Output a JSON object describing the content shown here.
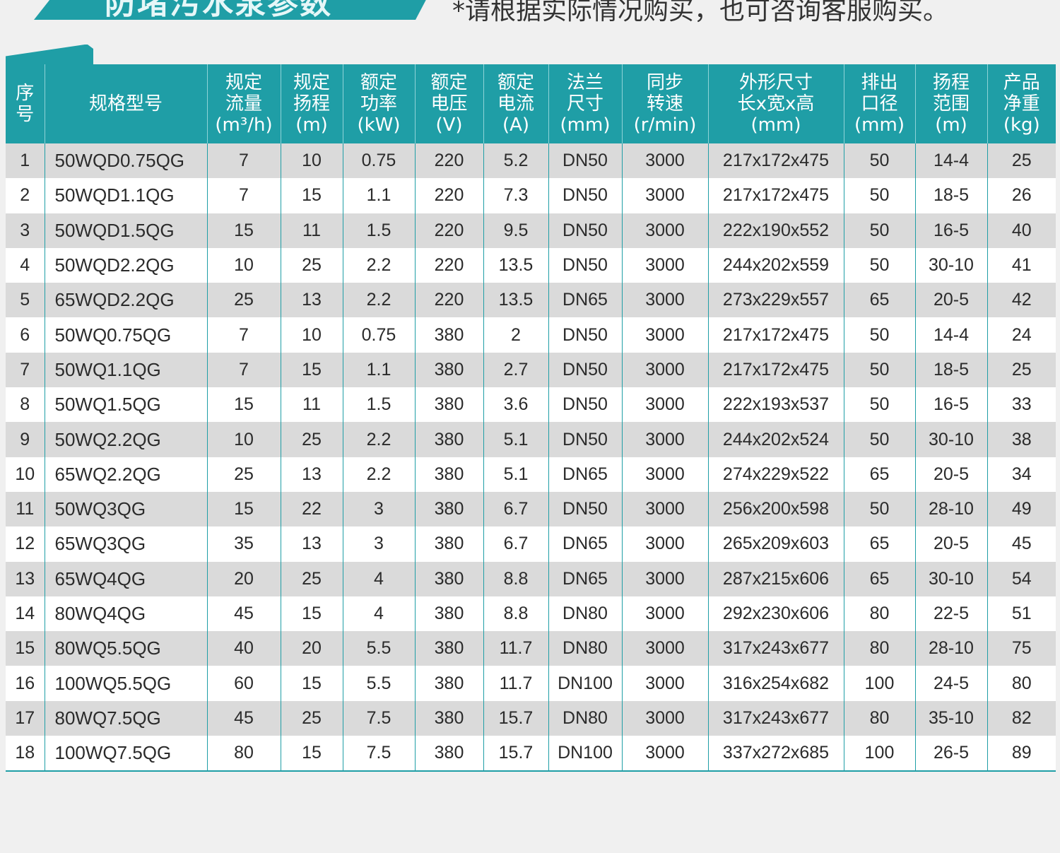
{
  "banner": {
    "title": "防堵污水泵参数"
  },
  "note": "*请根据实际情况购买，也可咨询客服购买。",
  "table": {
    "headers": [
      [
        "序",
        "号"
      ],
      [
        "规格型号"
      ],
      [
        "规定",
        "流量",
        "(m³/h)"
      ],
      [
        "规定",
        "扬程",
        "(m)"
      ],
      [
        "额定",
        "功率",
        "(kW)"
      ],
      [
        "额定",
        "电压",
        "(V)"
      ],
      [
        "额定",
        "电流",
        "(A)"
      ],
      [
        "法兰",
        "尺寸",
        "(mm)"
      ],
      [
        "同步",
        "转速",
        "(r/min)"
      ],
      [
        "外形尺寸",
        "长x宽x高",
        "(mm)"
      ],
      [
        "排出",
        "口径",
        "(mm)"
      ],
      [
        "扬程",
        "范围",
        "(m)"
      ],
      [
        "产品",
        "净重",
        "(kg)"
      ]
    ],
    "rows": [
      [
        "1",
        "50WQD0.75QG",
        "7",
        "10",
        "0.75",
        "220",
        "5.2",
        "DN50",
        "3000",
        "217x172x475",
        "50",
        "14-4",
        "25"
      ],
      [
        "2",
        "50WQD1.1QG",
        "7",
        "15",
        "1.1",
        "220",
        "7.3",
        "DN50",
        "3000",
        "217x172x475",
        "50",
        "18-5",
        "26"
      ],
      [
        "3",
        "50WQD1.5QG",
        "15",
        "11",
        "1.5",
        "220",
        "9.5",
        "DN50",
        "3000",
        "222x190x552",
        "50",
        "16-5",
        "40"
      ],
      [
        "4",
        "50WQD2.2QG",
        "10",
        "25",
        "2.2",
        "220",
        "13.5",
        "DN50",
        "3000",
        "244x202x559",
        "50",
        "30-10",
        "41"
      ],
      [
        "5",
        "65WQD2.2QG",
        "25",
        "13",
        "2.2",
        "220",
        "13.5",
        "DN65",
        "3000",
        "273x229x557",
        "65",
        "20-5",
        "42"
      ],
      [
        "6",
        "50WQ0.75QG",
        "7",
        "10",
        "0.75",
        "380",
        "2",
        "DN50",
        "3000",
        "217x172x475",
        "50",
        "14-4",
        "24"
      ],
      [
        "7",
        "50WQ1.1QG",
        "7",
        "15",
        "1.1",
        "380",
        "2.7",
        "DN50",
        "3000",
        "217x172x475",
        "50",
        "18-5",
        "25"
      ],
      [
        "8",
        "50WQ1.5QG",
        "15",
        "11",
        "1.5",
        "380",
        "3.6",
        "DN50",
        "3000",
        "222x193x537",
        "50",
        "16-5",
        "33"
      ],
      [
        "9",
        "50WQ2.2QG",
        "10",
        "25",
        "2.2",
        "380",
        "5.1",
        "DN50",
        "3000",
        "244x202x524",
        "50",
        "30-10",
        "38"
      ],
      [
        "10",
        "65WQ2.2QG",
        "25",
        "13",
        "2.2",
        "380",
        "5.1",
        "DN65",
        "3000",
        "274x229x522",
        "65",
        "20-5",
        "34"
      ],
      [
        "11",
        "50WQ3QG",
        "15",
        "22",
        "3",
        "380",
        "6.7",
        "DN50",
        "3000",
        "256x200x598",
        "50",
        "28-10",
        "49"
      ],
      [
        "12",
        "65WQ3QG",
        "35",
        "13",
        "3",
        "380",
        "6.7",
        "DN65",
        "3000",
        "265x209x603",
        "65",
        "20-5",
        "45"
      ],
      [
        "13",
        "65WQ4QG",
        "20",
        "25",
        "4",
        "380",
        "8.8",
        "DN65",
        "3000",
        "287x215x606",
        "65",
        "30-10",
        "54"
      ],
      [
        "14",
        "80WQ4QG",
        "45",
        "15",
        "4",
        "380",
        "8.8",
        "DN80",
        "3000",
        "292x230x606",
        "80",
        "22-5",
        "51"
      ],
      [
        "15",
        "80WQ5.5QG",
        "40",
        "20",
        "5.5",
        "380",
        "11.7",
        "DN80",
        "3000",
        "317x243x677",
        "80",
        "28-10",
        "75"
      ],
      [
        "16",
        "100WQ5.5QG",
        "60",
        "15",
        "5.5",
        "380",
        "11.7",
        "DN100",
        "3000",
        "316x254x682",
        "100",
        "24-5",
        "80"
      ],
      [
        "17",
        "80WQ7.5QG",
        "45",
        "25",
        "7.5",
        "380",
        "15.7",
        "DN80",
        "3000",
        "317x243x677",
        "80",
        "35-10",
        "82"
      ],
      [
        "18",
        "100WQ7.5QG",
        "80",
        "15",
        "7.5",
        "380",
        "15.7",
        "DN100",
        "3000",
        "337x272x685",
        "100",
        "26-5",
        "89"
      ]
    ]
  },
  "colors": {
    "accent": "#1f9ea6",
    "row_alt": "#dadada",
    "row": "#ffffff",
    "background": "#f0f0f0"
  }
}
